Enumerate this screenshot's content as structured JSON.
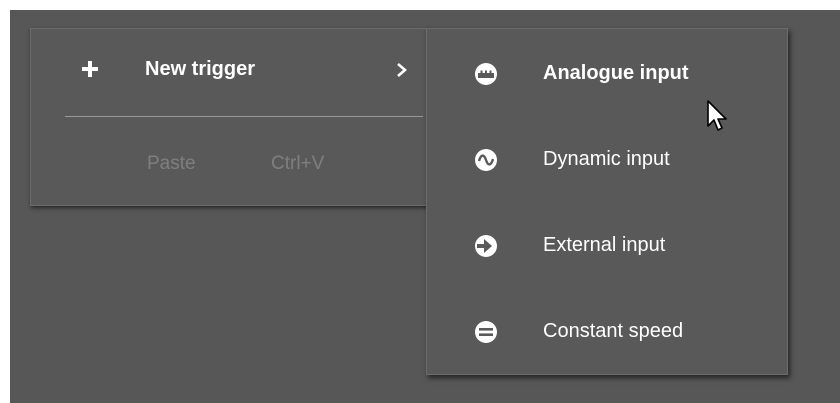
{
  "context_menu": {
    "new_trigger": {
      "icon": "plus-icon",
      "label": "New trigger",
      "submenu_indicator": "chevron-right-icon"
    },
    "paste": {
      "label": "Paste",
      "shortcut": "Ctrl+V",
      "enabled": false
    }
  },
  "submenu": {
    "items": [
      {
        "icon": "analogue-input-icon",
        "label": "Analogue input",
        "highlighted": true
      },
      {
        "icon": "dynamic-input-icon",
        "label": "Dynamic input",
        "highlighted": false
      },
      {
        "icon": "external-input-icon",
        "label": "External input",
        "highlighted": false
      },
      {
        "icon": "constant-speed-icon",
        "label": "Constant speed",
        "highlighted": false
      }
    ]
  },
  "colors": {
    "background": "#575757",
    "menu_background": "#595959",
    "text": "#ffffff",
    "disabled_text": "#7f7f7f"
  }
}
